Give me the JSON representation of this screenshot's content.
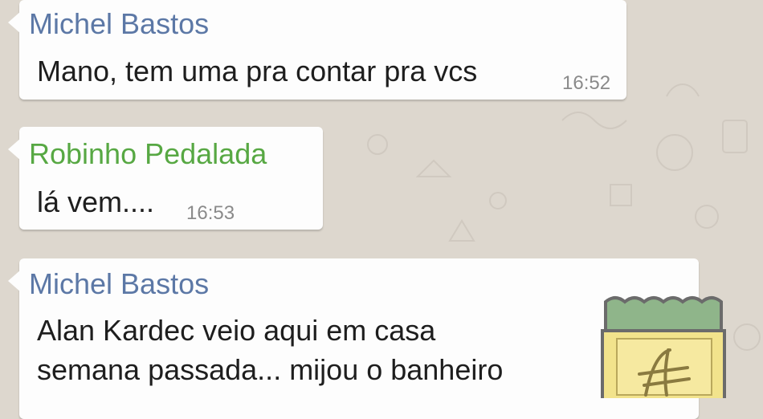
{
  "colors": {
    "background": "#ddd7ce",
    "bubble": "#fdfdfd",
    "sender_blue": "#5c78a6",
    "sender_green": "#57a843",
    "time": "#8a8a8a"
  },
  "messages": [
    {
      "sender": "Michel Bastos",
      "lines": [
        "Mano, tem uma pra contar pra vcs"
      ],
      "time": "16:52"
    },
    {
      "sender": "Robinho Pedalada",
      "lines": [
        "lá vem...."
      ],
      "time": "16:53"
    },
    {
      "sender": "Michel Bastos",
      "lines": [
        "Alan Kardec veio aqui em casa",
        "semana passada... mijou o banheiro"
      ],
      "time": ""
    }
  ],
  "sticker": {
    "icon": "spirit-jar-sticker-icon"
  }
}
